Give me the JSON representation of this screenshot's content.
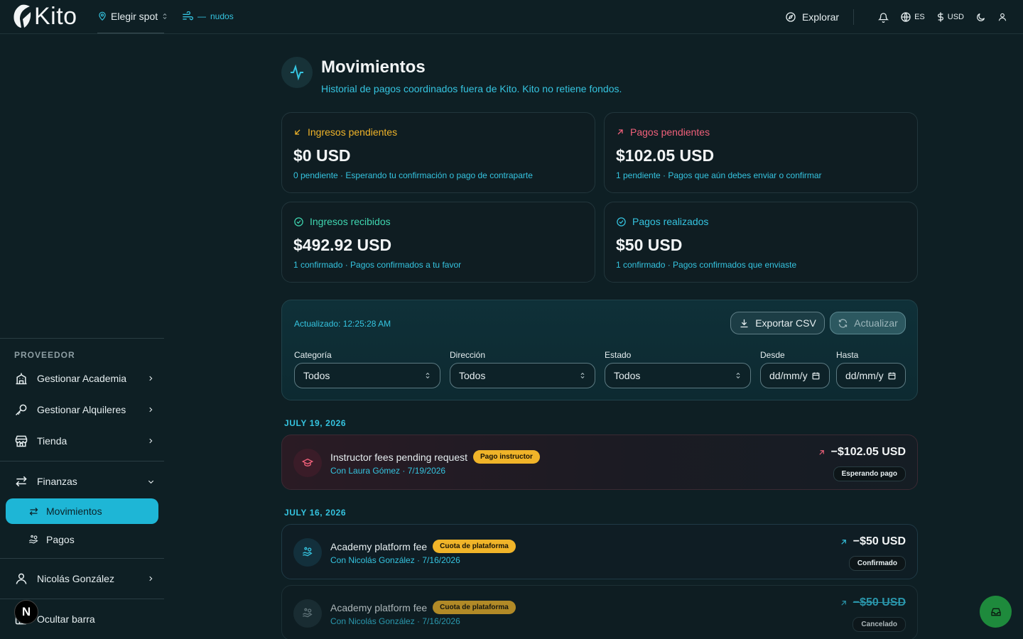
{
  "header": {
    "logo_text": "Kito",
    "spot_label": "Elegir spot",
    "knots_dash": "—",
    "knots_label": "nudos",
    "explore_label": "Explorar",
    "lang_label": "ES",
    "currency_label": "USD"
  },
  "sidebar": {
    "section_label": "PROVEEDOR",
    "items": [
      {
        "label": "Gestionar Academia"
      },
      {
        "label": "Gestionar Alquileres"
      },
      {
        "label": "Tienda"
      },
      {
        "label": "Finanzas"
      }
    ],
    "sub_items": [
      {
        "label": "Movimientos"
      },
      {
        "label": "Pagos"
      }
    ],
    "user_label": "Nicolás González",
    "hide_label": "Ocultar barra",
    "badge_letter": "N"
  },
  "page": {
    "title": "Movimientos",
    "subtitle": "Historial de pagos coordinados fuera de Kito. Kito no retiene fondos."
  },
  "summary": [
    {
      "title": "Ingresos pendientes",
      "value": "$0 USD",
      "note": "0 pendiente · Esperando tu confirmación o pago de contraparte",
      "color": "#f0b429"
    },
    {
      "title": "Pagos pendientes",
      "value": "$102.05 USD",
      "note": "1 pendiente · Pagos que aún debes enviar o confirmar",
      "color": "#f0607a"
    },
    {
      "title": "Ingresos recibidos",
      "value": "$492.92 USD",
      "note": "1 confirmado · Pagos confirmados a tu favor",
      "color": "#3fd6b0"
    },
    {
      "title": "Pagos realizados",
      "value": "$50 USD",
      "note": "1 confirmado · Pagos confirmados que enviaste",
      "color": "#35c4e0"
    }
  ],
  "filters": {
    "updated": "Actualizado: 12:25:28 AM",
    "export_label": "Exportar CSV",
    "refresh_label": "Actualizar",
    "category_label": "Categoría",
    "category_value": "Todos",
    "direction_label": "Dirección",
    "direction_value": "Todos",
    "status_label": "Estado",
    "status_value": "Todos",
    "from_label": "Desde",
    "from_value": "dd/mm/y",
    "to_label": "Hasta",
    "to_value": "dd/mm/y"
  },
  "groups": [
    {
      "date": "JULY 19, 2026"
    },
    {
      "date": "JULY 16, 2026"
    }
  ],
  "transactions": [
    {
      "title": "Instructor fees pending request",
      "tag": "Pago instructor",
      "sub": "Con Laura Gómez · 7/19/2026",
      "amount": "−$102.05 USD",
      "status": "Esperando pago"
    },
    {
      "title": "Academy platform fee",
      "tag": "Cuota de plataforma",
      "sub": "Con Nicolás González · 7/16/2026",
      "amount": "−$50 USD",
      "status": "Confirmado"
    },
    {
      "title": "Academy platform fee",
      "tag": "Cuota de plataforma",
      "sub": "Con Nicolás González · 7/16/2026",
      "amount": "−$50 USD",
      "status": "Cancelado"
    }
  ]
}
